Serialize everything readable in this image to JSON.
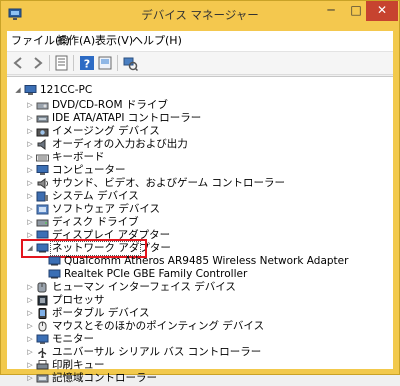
{
  "window": {
    "title": "デバイス マネージャー",
    "minimize": "─",
    "maximize": "□",
    "close": "✕"
  },
  "menu": [
    {
      "label": "ファイル(F)"
    },
    {
      "label": "操作(A)"
    },
    {
      "label": "表示(V)"
    },
    {
      "label": "ヘルプ(H)"
    }
  ],
  "toolbar": {
    "icons": [
      "back-icon",
      "forward-icon",
      "properties-icon",
      "help-icon",
      "show-hidden-icon",
      "scan-hardware-icon"
    ]
  },
  "tree": {
    "root": "121CC-PC",
    "items": [
      {
        "label": "DVD/CD-ROM ドライブ"
      },
      {
        "label": "IDE ATA/ATAPI コントローラー"
      },
      {
        "label": "イメージング デバイス"
      },
      {
        "label": "オーディオの入力および出力"
      },
      {
        "label": "キーボード"
      },
      {
        "label": "コンピューター"
      },
      {
        "label": "サウンド、ビデオ、およびゲーム コントローラー"
      },
      {
        "label": "システム デバイス"
      },
      {
        "label": "ソフトウェア デバイス"
      },
      {
        "label": "ディスク ドライブ"
      },
      {
        "label": "ディスプレイ アダプター"
      },
      {
        "label": "ネットワーク アダプター"
      },
      {
        "label": "Qualcomm Atheros AR9485 Wireless Network Adapter"
      },
      {
        "label": "Realtek PCIe GBE Family Controller"
      },
      {
        "label": "ヒューマン インターフェイス デバイス"
      },
      {
        "label": "プロセッサ"
      },
      {
        "label": "ポータブル デバイス"
      },
      {
        "label": "マウスとそのほかのポインティング デバイス"
      },
      {
        "label": "モニター"
      },
      {
        "label": "ユニバーサル シリアル バス コントローラー"
      },
      {
        "label": "印刷キュー"
      },
      {
        "label": "記憶域コントローラー"
      }
    ]
  },
  "colors": {
    "titlebar": "#f4c84e",
    "highlight": "#e3161e"
  }
}
